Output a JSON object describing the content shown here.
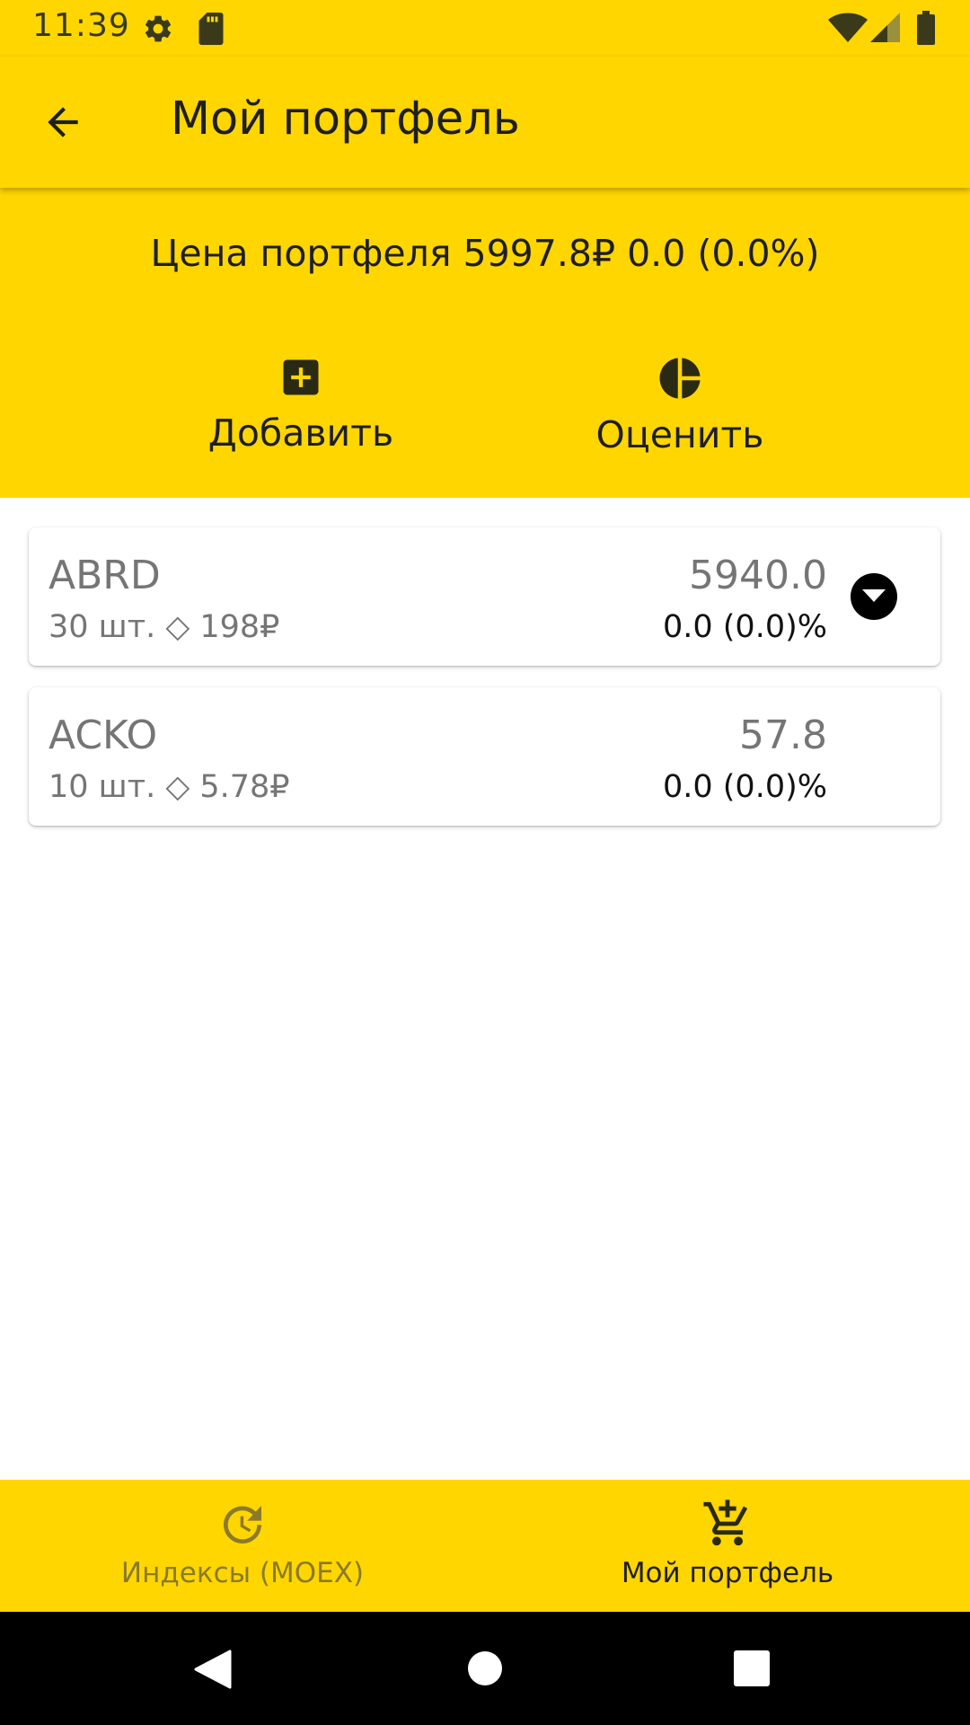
{
  "status_bar": {
    "time": "11:39",
    "icons": [
      "settings-icon",
      "sd-card-icon",
      "wifi-icon",
      "signal-icon",
      "battery-icon"
    ]
  },
  "app_bar": {
    "title": "Мой портфель",
    "back_icon": "arrow-back-icon"
  },
  "summary": {
    "price_text": "Цена портфеля 5997.8₽ 0.0 (0.0%)",
    "actions": [
      {
        "label": "Добавить",
        "icon": "add-box-icon"
      },
      {
        "label": "Оценить",
        "icon": "pie-chart-icon"
      }
    ]
  },
  "holdings": [
    {
      "ticker": "ABRD",
      "qty_text": "30 шт. ◇ 198₽",
      "total": "5940.0",
      "change": "0.0 (0.0)%",
      "expand_icon": "arrow-drop-down-circle-icon"
    },
    {
      "ticker": "ACKO",
      "qty_text": "10 шт. ◇ 5.78₽",
      "total": "57.8",
      "change": "0.0 (0.0)%"
    }
  ],
  "bottom_nav": {
    "items": [
      {
        "label": "Индексы (MOEX)",
        "icon": "history-clock-icon",
        "active": false
      },
      {
        "label": "Мой портфель",
        "icon": "add-shopping-cart-icon",
        "active": true
      }
    ]
  },
  "system_nav": [
    "back-triangle-icon",
    "home-circle-icon",
    "recents-square-icon"
  ],
  "colors": {
    "primary": "#FFD600",
    "text_dark": "#1f1f1f",
    "text_secondary": "#757575",
    "nav_inactive": "#8a7a2a"
  }
}
